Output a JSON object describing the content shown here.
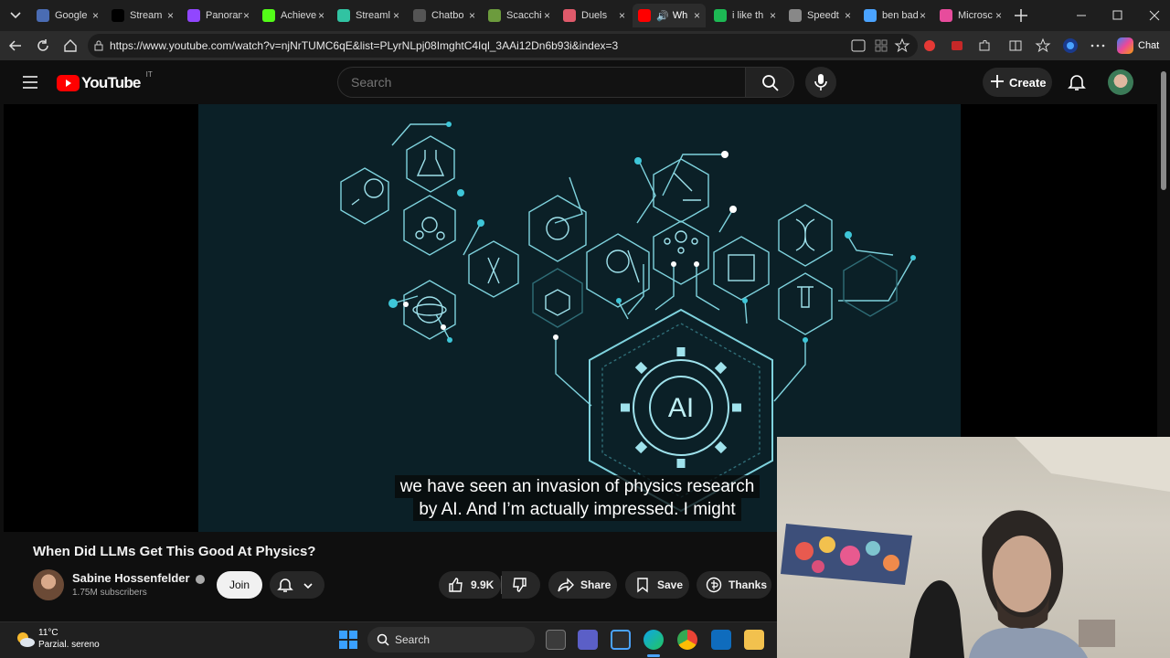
{
  "browser": {
    "tabs": [
      {
        "title": "Google",
        "icon": "google-favicon",
        "color": "#4a6cb3"
      },
      {
        "title": "Stream",
        "icon": "x-favicon",
        "color": "#000000"
      },
      {
        "title": "Panoran",
        "icon": "twitch-favicon",
        "color": "#9146ff"
      },
      {
        "title": "Achieve",
        "icon": "kick-favicon",
        "color": "#53fc18"
      },
      {
        "title": "Streaml",
        "icon": "streamlabs-favicon",
        "color": "#31c3a2"
      },
      {
        "title": "Chatbo",
        "icon": "chatbot-favicon",
        "color": "#555555"
      },
      {
        "title": "Scacchi",
        "icon": "chess-favicon",
        "color": "#6c9b3d"
      },
      {
        "title": "Duels",
        "icon": "geoguessr-favicon",
        "color": "#e05a6b"
      },
      {
        "title": "Wh",
        "icon": "youtube-favicon",
        "color": "#ff0000",
        "active": true
      },
      {
        "title": "i like th",
        "icon": "spotify-favicon",
        "color": "#1db954"
      },
      {
        "title": "Speedt",
        "icon": "speedtest-favicon",
        "color": "#888888"
      },
      {
        "title": "ben bad",
        "icon": "search-favicon",
        "color": "#4aa3ff"
      },
      {
        "title": "Microsc",
        "icon": "copilot-favicon",
        "color": "#e74c9c"
      }
    ],
    "url": "https://www.youtube.com/watch?v=njNrTUMC6qE&list=PLyrNLpj08ImghtC4Iql_3AAi12Dn6b93i&index=3",
    "chat_label": "Chat"
  },
  "youtube": {
    "logo_text": "YouTube",
    "country": "IT",
    "search_placeholder": "Search",
    "create_label": "Create"
  },
  "video": {
    "gear_text": "AI",
    "caption_line1": "we have seen an invasion of physics research",
    "caption_line2": "by AI. And I’m actually impressed. I might",
    "title": "When Did LLMs Get This Good At Physics?",
    "channel": "Sabine Hossenfelder",
    "subscribers": "1.75M subscribers",
    "join_label": "Join",
    "likes": "9.9K",
    "share_label": "Share",
    "save_label": "Save",
    "thanks_label": "Thanks"
  },
  "taskbar": {
    "temperature": "11°C",
    "weather": "Parzial. sereno",
    "search_label": "Search"
  },
  "colors": {
    "youtube_red": "#ff0000",
    "video_bg": "#0b2027",
    "line_cyan": "#7fd3de",
    "dot_cyan": "#3ec6d8"
  }
}
